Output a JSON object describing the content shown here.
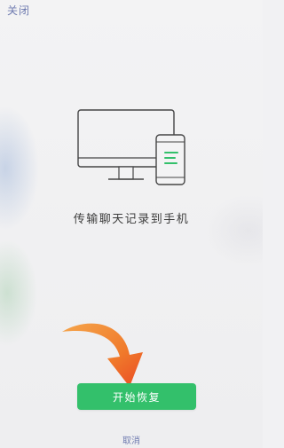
{
  "header": {
    "close_label": "关闭"
  },
  "main": {
    "caption": "传输聊天记录到手机"
  },
  "actions": {
    "start_label": "开始恢复",
    "cancel_label": "取消"
  },
  "colors": {
    "primary_green": "#33c06b",
    "link_blue": "#6f7bb0",
    "arrow_orange": "#f0832e"
  },
  "icons": [
    "monitor-icon",
    "phone-icon",
    "curved-arrow-icon"
  ]
}
